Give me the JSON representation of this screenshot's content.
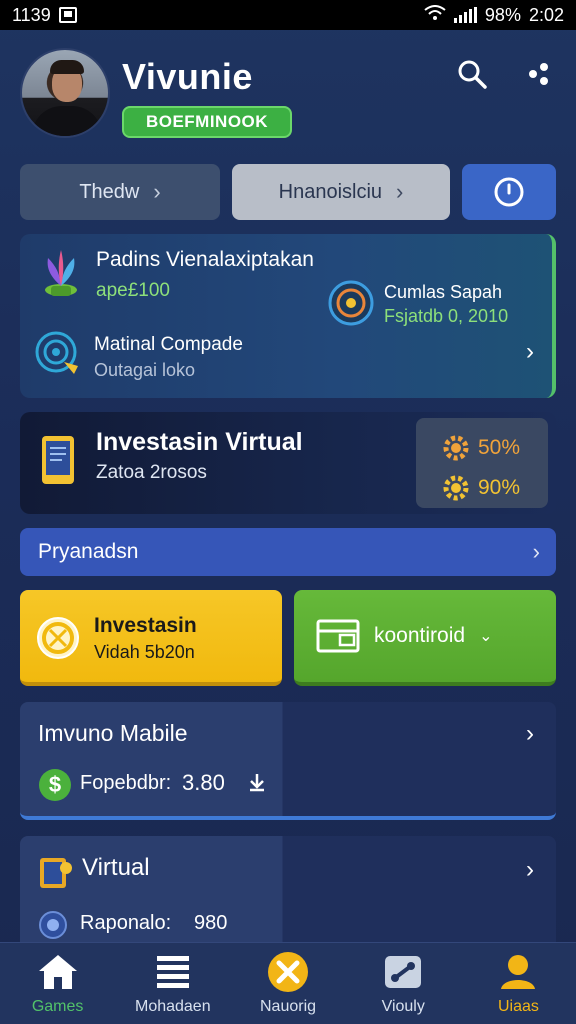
{
  "status_bar": {
    "time": "1139",
    "battery": "98%",
    "clock": "2:02"
  },
  "header": {
    "user_name": "Vivunie",
    "badge": "BOEFMINOOK"
  },
  "chips": [
    {
      "label": "Thedw"
    },
    {
      "label": "Hnanoislciu"
    }
  ],
  "card_a": {
    "title": "Padins Vienalaxiptakan",
    "subtitle": "ape£100",
    "right_title": "Cumlas Sapah",
    "right_subtitle": "Fsjatdb 0, 2010",
    "row2_title": "Matinal Compade",
    "row2_subtitle": "Outagai loko"
  },
  "card_b": {
    "title": "Investasin Virtual",
    "subtitle": "Zatoa 2rosos",
    "stat1": "50%",
    "stat2": "90%"
  },
  "banner": {
    "label": "Pryanadsn"
  },
  "tile_yellow": {
    "title": "Investasin",
    "subtitle": "Vidah 5b20n"
  },
  "tile_green": {
    "label": "koontiroid"
  },
  "card_c": {
    "title": "Imvuno Mabile",
    "label": "Fopebdbr:",
    "value": "3.80"
  },
  "card_d": {
    "title": "Virtual",
    "label": "Raponalo:",
    "value": "980"
  },
  "bottom_nav": [
    {
      "label": "Games"
    },
    {
      "label": "Mohadaen"
    },
    {
      "label": "Nauorig"
    },
    {
      "label": "Viouly"
    },
    {
      "label": "Uiaas"
    }
  ],
  "colors": {
    "accent_green": "#3cb043",
    "accent_yellow": "#f2b516",
    "accent_blue": "#3656b8"
  }
}
